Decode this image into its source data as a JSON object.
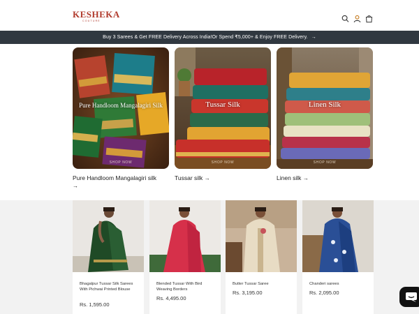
{
  "brand": {
    "name": "KESHEKA",
    "tagline": "COUTURE"
  },
  "header": {
    "icons": [
      "search-icon",
      "user-icon",
      "cart-icon"
    ]
  },
  "announcement": {
    "text": "Buy 3 Sarees & Get FREE Delivery Across India!Or Spend ₹5,000+ & Enjoy FREE Delivery.",
    "arrow": "→"
  },
  "collections": [
    {
      "overlay": "Pure Handloom Mangalagiri Silk",
      "shop": "SHOP NOW",
      "label": "Pure Handloom Mangalagiri silk",
      "arrow": "→"
    },
    {
      "overlay": "Tussar Silk",
      "shop": "SHOP NOW",
      "label": "Tussar silk",
      "arrow": "→"
    },
    {
      "overlay": "Linen Silk",
      "shop": "SHOP NOW",
      "label": "Linen silk",
      "arrow": "→"
    }
  ],
  "products": [
    {
      "name": "Bhagalpur Tussar Silk Sarees With Pichwai Printed Blouse",
      "price": "Rs. 1,595.00"
    },
    {
      "name": "Blended Tussar With Bird Weaving Borders",
      "price": "Rs. 4,495.00"
    },
    {
      "name": "Butter Tussar Saree",
      "price": "Rs. 3,195.00"
    },
    {
      "name": "Chanderi sarees",
      "price": "Rs. 2,095.00"
    }
  ],
  "colors": {
    "brand": "#b0392b",
    "announcement_bg": "#303840",
    "section_bg": "#f2f2f2",
    "chat_bg": "#121212"
  }
}
